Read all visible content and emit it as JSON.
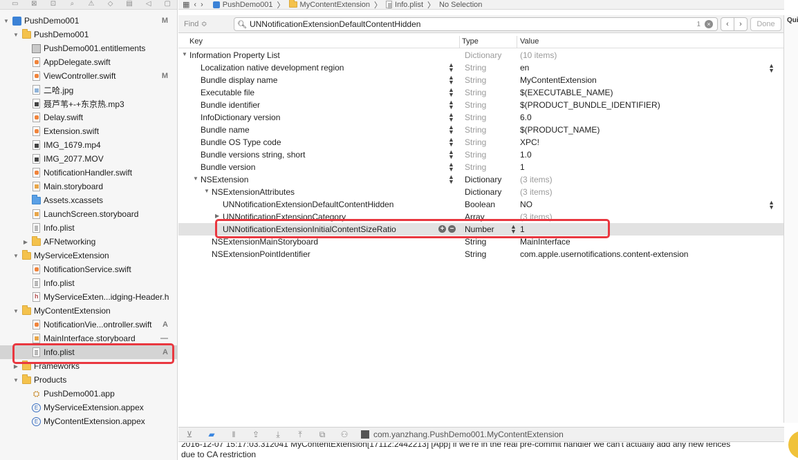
{
  "navigator": {
    "toolbar_icons": [
      "folder-icon",
      "source-control-icon",
      "symbol-icon",
      "find-icon",
      "issue-icon",
      "test-icon",
      "debug-icon",
      "breakpoint-icon",
      "report-icon"
    ],
    "items": [
      {
        "label": "PushDemo001",
        "status": "M",
        "depth": 0,
        "kind": "project",
        "disclosure": "open"
      },
      {
        "label": "PushDemo001",
        "status": "",
        "depth": 1,
        "kind": "folder",
        "disclosure": "open"
      },
      {
        "label": "PushDemo001.entitlements",
        "status": "",
        "depth": 2,
        "kind": "entitlements",
        "disclosure": ""
      },
      {
        "label": "AppDelegate.swift",
        "status": "",
        "depth": 2,
        "kind": "swift",
        "disclosure": ""
      },
      {
        "label": "ViewController.swift",
        "status": "M",
        "depth": 2,
        "kind": "swift",
        "disclosure": ""
      },
      {
        "label": "二哈.jpg",
        "status": "",
        "depth": 2,
        "kind": "img",
        "disclosure": ""
      },
      {
        "label": "聂芦苇+-+东京热.mp3",
        "status": "",
        "depth": 2,
        "kind": "media",
        "disclosure": ""
      },
      {
        "label": "Delay.swift",
        "status": "",
        "depth": 2,
        "kind": "swift",
        "disclosure": ""
      },
      {
        "label": "Extension.swift",
        "status": "",
        "depth": 2,
        "kind": "swift",
        "disclosure": ""
      },
      {
        "label": "IMG_1679.mp4",
        "status": "",
        "depth": 2,
        "kind": "media",
        "disclosure": ""
      },
      {
        "label": "IMG_2077.MOV",
        "status": "",
        "depth": 2,
        "kind": "media",
        "disclosure": ""
      },
      {
        "label": "NotificationHandler.swift",
        "status": "",
        "depth": 2,
        "kind": "swift",
        "disclosure": ""
      },
      {
        "label": "Main.storyboard",
        "status": "",
        "depth": 2,
        "kind": "sb",
        "disclosure": ""
      },
      {
        "label": "Assets.xcassets",
        "status": "",
        "depth": 2,
        "kind": "folder-blue",
        "disclosure": ""
      },
      {
        "label": "LaunchScreen.storyboard",
        "status": "",
        "depth": 2,
        "kind": "sb",
        "disclosure": ""
      },
      {
        "label": "Info.plist",
        "status": "",
        "depth": 2,
        "kind": "plist",
        "disclosure": ""
      },
      {
        "label": "AFNetworking",
        "status": "",
        "depth": 2,
        "kind": "folder",
        "disclosure": "closed"
      },
      {
        "label": "MyServiceExtension",
        "status": "",
        "depth": 1,
        "kind": "folder",
        "disclosure": "open"
      },
      {
        "label": "NotificationService.swift",
        "status": "",
        "depth": 2,
        "kind": "swift",
        "disclosure": ""
      },
      {
        "label": "Info.plist",
        "status": "",
        "depth": 2,
        "kind": "plist",
        "disclosure": ""
      },
      {
        "label": "MyServiceExten...idging-Header.h",
        "status": "",
        "depth": 2,
        "kind": "hdr",
        "disclosure": ""
      },
      {
        "label": "MyContentExtension",
        "status": "",
        "depth": 1,
        "kind": "folder",
        "disclosure": "open"
      },
      {
        "label": "NotificationVie...ontroller.swift",
        "status": "A",
        "depth": 2,
        "kind": "swift",
        "disclosure": ""
      },
      {
        "label": "MainInterface.storyboard",
        "status": "—",
        "depth": 2,
        "kind": "sb",
        "disclosure": ""
      },
      {
        "label": "Info.plist",
        "status": "A",
        "depth": 2,
        "kind": "plist",
        "disclosure": "",
        "selected": true
      },
      {
        "label": "Frameworks",
        "status": "",
        "depth": 1,
        "kind": "folder",
        "disclosure": "closed"
      },
      {
        "label": "Products",
        "status": "",
        "depth": 1,
        "kind": "folder",
        "disclosure": "open"
      },
      {
        "label": "PushDemo001.app",
        "status": "",
        "depth": 2,
        "kind": "app",
        "disclosure": ""
      },
      {
        "label": "MyServiceExtension.appex",
        "status": "",
        "depth": 2,
        "kind": "appex",
        "disclosure": ""
      },
      {
        "label": "MyContentExtension.appex",
        "status": "",
        "depth": 2,
        "kind": "appex",
        "disclosure": ""
      }
    ]
  },
  "jump_bar": {
    "crumbs": [
      "PushDemo001",
      "MyContentExtension",
      "Info.plist",
      "No Selection"
    ]
  },
  "find_bar": {
    "mode_label": "Find ≎",
    "query": "UNNotificationExtensionDefaultContentHidden",
    "match_count": "1",
    "prev_label": "‹",
    "next_label": "›",
    "done_label": "Done"
  },
  "plist": {
    "columns": {
      "key": "Key",
      "type": "Type",
      "value": "Value"
    },
    "rows": [
      {
        "key": "Information Property List",
        "type": "Dictionary",
        "value": "(10 items)",
        "depth": 0,
        "disclosure": "open",
        "dim": true,
        "stepper": false
      },
      {
        "key": "Localization native development region",
        "type": "String",
        "value": "en",
        "depth": 1,
        "disclosure": "",
        "dim": true,
        "stepper": true,
        "value_stepper": true
      },
      {
        "key": "Bundle display name",
        "type": "String",
        "value": "MyContentExtension",
        "depth": 1,
        "disclosure": "",
        "dim": true,
        "stepper": true
      },
      {
        "key": "Executable file",
        "type": "String",
        "value": "$(EXECUTABLE_NAME)",
        "depth": 1,
        "disclosure": "",
        "dim": true,
        "stepper": true
      },
      {
        "key": "Bundle identifier",
        "type": "String",
        "value": "$(PRODUCT_BUNDLE_IDENTIFIER)",
        "depth": 1,
        "disclosure": "",
        "dim": true,
        "stepper": true
      },
      {
        "key": "InfoDictionary version",
        "type": "String",
        "value": "6.0",
        "depth": 1,
        "disclosure": "",
        "dim": true,
        "stepper": true
      },
      {
        "key": "Bundle name",
        "type": "String",
        "value": "$(PRODUCT_NAME)",
        "depth": 1,
        "disclosure": "",
        "dim": true,
        "stepper": true
      },
      {
        "key": "Bundle OS Type code",
        "type": "String",
        "value": "XPC!",
        "depth": 1,
        "disclosure": "",
        "dim": true,
        "stepper": true
      },
      {
        "key": "Bundle versions string, short",
        "type": "String",
        "value": "1.0",
        "depth": 1,
        "disclosure": "",
        "dim": true,
        "stepper": true
      },
      {
        "key": "Bundle version",
        "type": "String",
        "value": "1",
        "depth": 1,
        "disclosure": "",
        "dim": true,
        "stepper": true
      },
      {
        "key": "NSExtension",
        "type": "Dictionary",
        "value": "(3 items)",
        "depth": 1,
        "disclosure": "open",
        "dim": false,
        "stepper": true
      },
      {
        "key": "NSExtensionAttributes",
        "type": "Dictionary",
        "value": "(3 items)",
        "depth": 2,
        "disclosure": "open",
        "dim": false,
        "stepper": false
      },
      {
        "key": "UNNotificationExtensionDefaultContentHidden",
        "type": "Boolean",
        "value": "NO",
        "depth": 3,
        "disclosure": "",
        "dim": false,
        "stepper": false,
        "value_stepper": true
      },
      {
        "key": "UNNotificationExtensionCategory",
        "type": "Array",
        "value": "(3 items)",
        "depth": 3,
        "disclosure": "closed",
        "dim": false,
        "stepper": false
      },
      {
        "key": "UNNotificationExtensionInitialContentSizeRatio",
        "type": "Number",
        "value": "1",
        "depth": 3,
        "disclosure": "",
        "dim": false,
        "stepper": false,
        "selected": true
      },
      {
        "key": "NSExtensionMainStoryboard",
        "type": "String",
        "value": "MainInterface",
        "depth": 2,
        "disclosure": "",
        "dim": false,
        "stepper": false
      },
      {
        "key": "NSExtensionPointIdentifier",
        "type": "String",
        "value": "com.apple.usernotifications.content-extension",
        "depth": 2,
        "disclosure": "",
        "dim": false,
        "stepper": false
      }
    ]
  },
  "inspector": {
    "label": "Qui"
  },
  "debug_bar": {
    "target": "com.yanzhang.PushDemo001.MyContentExtension"
  },
  "console": {
    "lines": [
      "2016-12-07 15:17:03.312041 MyContentExtension[17112:2442213] [App] if we're in the real pre-commit handler we can't actually add any new fences",
      "due to CA restriction"
    ]
  },
  "colors": {
    "highlight": "#e9373f",
    "folder": "#f4c24c",
    "accent": "#3a86e0"
  }
}
